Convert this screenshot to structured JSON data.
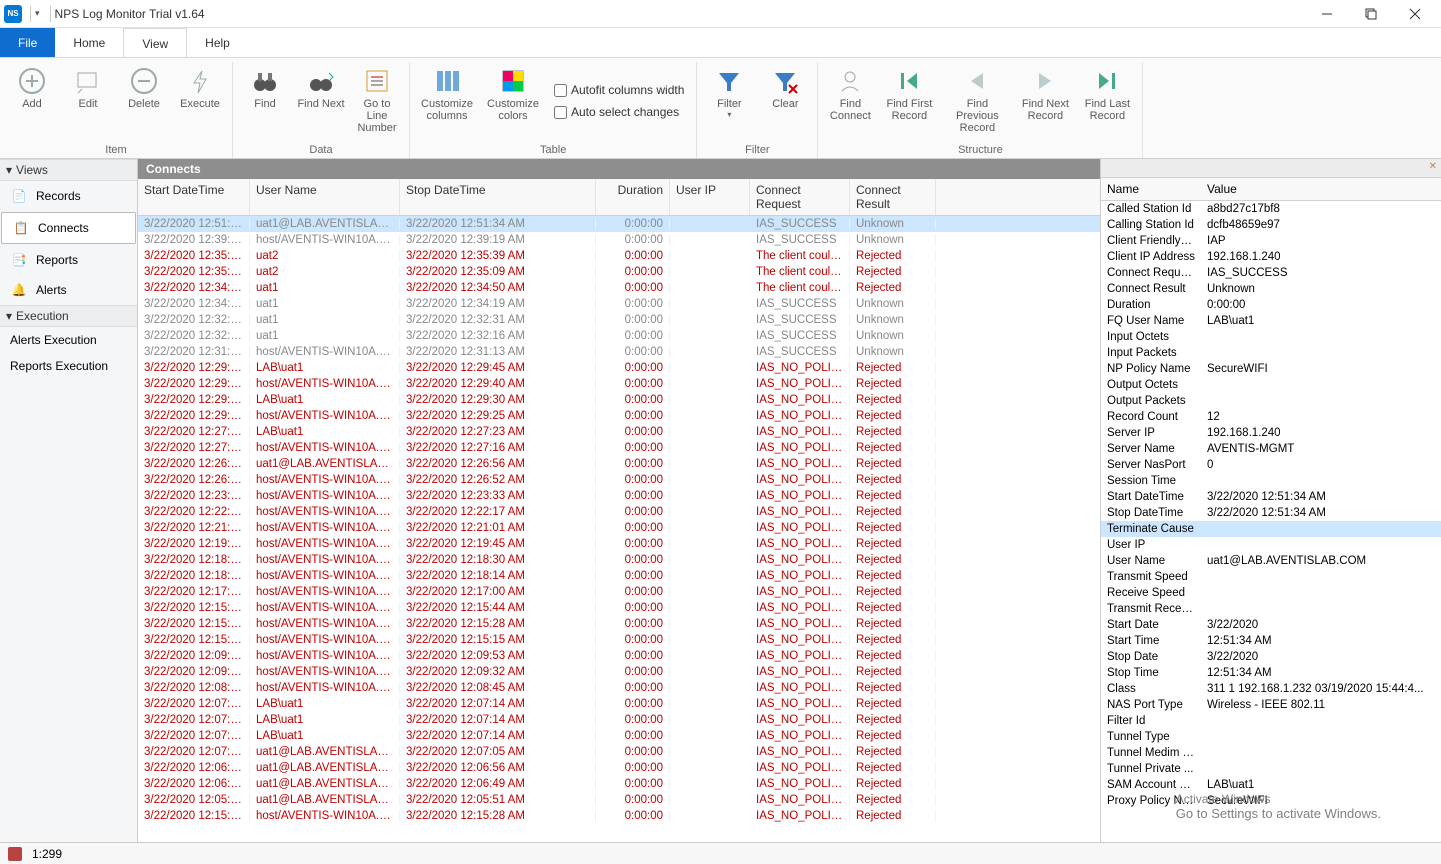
{
  "title": "NPS Log Monitor Trial v1.64",
  "menu": {
    "file": "File",
    "home": "Home",
    "view": "View",
    "help": "Help"
  },
  "ribbon": {
    "item": {
      "add": "Add",
      "edit": "Edit",
      "delete": "Delete",
      "execute": "Execute",
      "label": "Item"
    },
    "data": {
      "find": "Find",
      "findnext": "Find\nNext",
      "gotoline": "Go to Line\nNumber",
      "label": "Data"
    },
    "table": {
      "custcols": "Customize\ncolumns",
      "custcolors": "Customize\ncolors",
      "autofit": "Autofit columns width",
      "autoselect": "Auto select changes",
      "label": "Table"
    },
    "filter": {
      "filter": "Filter",
      "clear": "Clear",
      "label": "Filter"
    },
    "structure": {
      "findconnect": "Find\nConnect",
      "findfirst": "Find First\nRecord",
      "findprev": "Find Previous\nRecord",
      "findnext": "Find Next\nRecord",
      "findlast": "Find Last\nRecord",
      "label": "Structure"
    }
  },
  "leftnav": {
    "views": "Views",
    "records": "Records",
    "connects": "Connects",
    "reports": "Reports",
    "alerts": "Alerts",
    "execution": "Execution",
    "alerts_exec": "Alerts Execution",
    "reports_exec": "Reports Execution"
  },
  "grid": {
    "title": "Connects",
    "cols": [
      "Start DateTime",
      "User Name",
      "Stop DateTime",
      "Duration",
      "User IP",
      "Connect Request",
      "Connect Result"
    ],
    "rows": [
      {
        "cls": "gray sel",
        "c": [
          "3/22/2020 12:51:3...",
          "uat1@LAB.AVENTISLAB.COM",
          "3/22/2020 12:51:34 AM",
          "0:00:00",
          "",
          "IAS_SUCCESS",
          "Unknown"
        ]
      },
      {
        "cls": "gray",
        "c": [
          "3/22/2020 12:39:1...",
          "host/AVENTIS-WIN10A.LAB...",
          "3/22/2020 12:39:19 AM",
          "0:00:00",
          "",
          "IAS_SUCCESS",
          "Unknown"
        ]
      },
      {
        "cls": "red",
        "c": [
          "3/22/2020 12:35:3...",
          "uat2",
          "3/22/2020 12:35:39 AM",
          "0:00:00",
          "",
          "The client could ...",
          "Rejected"
        ]
      },
      {
        "cls": "red",
        "c": [
          "3/22/2020 12:35:0...",
          "uat2",
          "3/22/2020 12:35:09 AM",
          "0:00:00",
          "",
          "The client could ...",
          "Rejected"
        ]
      },
      {
        "cls": "red",
        "c": [
          "3/22/2020 12:34:5...",
          "uat1",
          "3/22/2020 12:34:50 AM",
          "0:00:00",
          "",
          "The client could ...",
          "Rejected"
        ]
      },
      {
        "cls": "gray",
        "c": [
          "3/22/2020 12:34:1...",
          "uat1",
          "3/22/2020 12:34:19 AM",
          "0:00:00",
          "",
          "IAS_SUCCESS",
          "Unknown"
        ]
      },
      {
        "cls": "gray",
        "c": [
          "3/22/2020 12:32:3...",
          "uat1",
          "3/22/2020 12:32:31 AM",
          "0:00:00",
          "",
          "IAS_SUCCESS",
          "Unknown"
        ]
      },
      {
        "cls": "gray",
        "c": [
          "3/22/2020 12:32:1...",
          "uat1",
          "3/22/2020 12:32:16 AM",
          "0:00:00",
          "",
          "IAS_SUCCESS",
          "Unknown"
        ]
      },
      {
        "cls": "gray",
        "c": [
          "3/22/2020 12:31:1...",
          "host/AVENTIS-WIN10A.LAB...",
          "3/22/2020 12:31:13 AM",
          "0:00:00",
          "",
          "IAS_SUCCESS",
          "Unknown"
        ]
      },
      {
        "cls": "red",
        "c": [
          "3/22/2020 12:29:4...",
          "LAB\\uat1",
          "3/22/2020 12:29:45 AM",
          "0:00:00",
          "",
          "IAS_NO_POLIC...",
          "Rejected"
        ]
      },
      {
        "cls": "red",
        "c": [
          "3/22/2020 12:29:4...",
          "host/AVENTIS-WIN10A.LAB...",
          "3/22/2020 12:29:40 AM",
          "0:00:00",
          "",
          "IAS_NO_POLIC...",
          "Rejected"
        ]
      },
      {
        "cls": "red",
        "c": [
          "3/22/2020 12:29:3...",
          "LAB\\uat1",
          "3/22/2020 12:29:30 AM",
          "0:00:00",
          "",
          "IAS_NO_POLIC...",
          "Rejected"
        ]
      },
      {
        "cls": "red",
        "c": [
          "3/22/2020 12:29:2...",
          "host/AVENTIS-WIN10A.LAB...",
          "3/22/2020 12:29:25 AM",
          "0:00:00",
          "",
          "IAS_NO_POLIC...",
          "Rejected"
        ]
      },
      {
        "cls": "red",
        "c": [
          "3/22/2020 12:27:2...",
          "LAB\\uat1",
          "3/22/2020 12:27:23 AM",
          "0:00:00",
          "",
          "IAS_NO_POLIC...",
          "Rejected"
        ]
      },
      {
        "cls": "red",
        "c": [
          "3/22/2020 12:27:1...",
          "host/AVENTIS-WIN10A.LAB...",
          "3/22/2020 12:27:16 AM",
          "0:00:00",
          "",
          "IAS_NO_POLIC...",
          "Rejected"
        ]
      },
      {
        "cls": "red",
        "c": [
          "3/22/2020 12:26:5...",
          "uat1@LAB.AVENTISLAB.COM",
          "3/22/2020 12:26:56 AM",
          "0:00:00",
          "",
          "IAS_NO_POLIC...",
          "Rejected"
        ]
      },
      {
        "cls": "red",
        "c": [
          "3/22/2020 12:26:5...",
          "host/AVENTIS-WIN10A.LAB...",
          "3/22/2020 12:26:52 AM",
          "0:00:00",
          "",
          "IAS_NO_POLIC...",
          "Rejected"
        ]
      },
      {
        "cls": "red",
        "c": [
          "3/22/2020 12:23:3...",
          "host/AVENTIS-WIN10A.LAB...",
          "3/22/2020 12:23:33 AM",
          "0:00:00",
          "",
          "IAS_NO_POLIC...",
          "Rejected"
        ]
      },
      {
        "cls": "red",
        "c": [
          "3/22/2020 12:22:1...",
          "host/AVENTIS-WIN10A.LAB...",
          "3/22/2020 12:22:17 AM",
          "0:00:00",
          "",
          "IAS_NO_POLIC...",
          "Rejected"
        ]
      },
      {
        "cls": "red",
        "c": [
          "3/22/2020 12:21:0...",
          "host/AVENTIS-WIN10A.LAB...",
          "3/22/2020 12:21:01 AM",
          "0:00:00",
          "",
          "IAS_NO_POLIC...",
          "Rejected"
        ]
      },
      {
        "cls": "red",
        "c": [
          "3/22/2020 12:19:4...",
          "host/AVENTIS-WIN10A.LAB...",
          "3/22/2020 12:19:45 AM",
          "0:00:00",
          "",
          "IAS_NO_POLIC...",
          "Rejected"
        ]
      },
      {
        "cls": "red",
        "c": [
          "3/22/2020 12:18:3...",
          "host/AVENTIS-WIN10A.LAB...",
          "3/22/2020 12:18:30 AM",
          "0:00:00",
          "",
          "IAS_NO_POLIC...",
          "Rejected"
        ]
      },
      {
        "cls": "red",
        "c": [
          "3/22/2020 12:18:1...",
          "host/AVENTIS-WIN10A.LAB...",
          "3/22/2020 12:18:14 AM",
          "0:00:00",
          "",
          "IAS_NO_POLIC...",
          "Rejected"
        ]
      },
      {
        "cls": "red",
        "c": [
          "3/22/2020 12:17:0...",
          "host/AVENTIS-WIN10A.LAB...",
          "3/22/2020 12:17:00 AM",
          "0:00:00",
          "",
          "IAS_NO_POLIC...",
          "Rejected"
        ]
      },
      {
        "cls": "red",
        "c": [
          "3/22/2020 12:15:4...",
          "host/AVENTIS-WIN10A.LAB...",
          "3/22/2020 12:15:44 AM",
          "0:00:00",
          "",
          "IAS_NO_POLIC...",
          "Rejected"
        ]
      },
      {
        "cls": "red",
        "c": [
          "3/22/2020 12:15:2...",
          "host/AVENTIS-WIN10A.LAB...",
          "3/22/2020 12:15:28 AM",
          "0:00:00",
          "",
          "IAS_NO_POLIC...",
          "Rejected"
        ]
      },
      {
        "cls": "red",
        "c": [
          "3/22/2020 12:15:1...",
          "host/AVENTIS-WIN10A.LAB...",
          "3/22/2020 12:15:15 AM",
          "0:00:00",
          "",
          "IAS_NO_POLIC...",
          "Rejected"
        ]
      },
      {
        "cls": "red",
        "c": [
          "3/22/2020 12:09:5...",
          "host/AVENTIS-WIN10A.LAB...",
          "3/22/2020 12:09:53 AM",
          "0:00:00",
          "",
          "IAS_NO_POLIC...",
          "Rejected"
        ]
      },
      {
        "cls": "red",
        "c": [
          "3/22/2020 12:09:3...",
          "host/AVENTIS-WIN10A.LAB...",
          "3/22/2020 12:09:32 AM",
          "0:00:00",
          "",
          "IAS_NO_POLIC...",
          "Rejected"
        ]
      },
      {
        "cls": "red",
        "c": [
          "3/22/2020 12:08:4...",
          "host/AVENTIS-WIN10A.LAB...",
          "3/22/2020 12:08:45 AM",
          "0:00:00",
          "",
          "IAS_NO_POLIC...",
          "Rejected"
        ]
      },
      {
        "cls": "red",
        "c": [
          "3/22/2020 12:07:1...",
          "LAB\\uat1",
          "3/22/2020 12:07:14 AM",
          "0:00:00",
          "",
          "IAS_NO_POLIC...",
          "Rejected"
        ]
      },
      {
        "cls": "red",
        "c": [
          "3/22/2020 12:07:1...",
          "LAB\\uat1",
          "3/22/2020 12:07:14 AM",
          "0:00:00",
          "",
          "IAS_NO_POLIC...",
          "Rejected"
        ]
      },
      {
        "cls": "red",
        "c": [
          "3/22/2020 12:07:1...",
          "LAB\\uat1",
          "3/22/2020 12:07:14 AM",
          "0:00:00",
          "",
          "IAS_NO_POLIC...",
          "Rejected"
        ]
      },
      {
        "cls": "red",
        "c": [
          "3/22/2020 12:07:0...",
          "uat1@LAB.AVENTISLAB.COM",
          "3/22/2020 12:07:05 AM",
          "0:00:00",
          "",
          "IAS_NO_POLIC...",
          "Rejected"
        ]
      },
      {
        "cls": "red",
        "c": [
          "3/22/2020 12:06:5...",
          "uat1@LAB.AVENTISLAB.COM",
          "3/22/2020 12:06:56 AM",
          "0:00:00",
          "",
          "IAS_NO_POLIC...",
          "Rejected"
        ]
      },
      {
        "cls": "red",
        "c": [
          "3/22/2020 12:06:4...",
          "uat1@LAB.AVENTISLAB.COM",
          "3/22/2020 12:06:49 AM",
          "0:00:00",
          "",
          "IAS_NO_POLIC...",
          "Rejected"
        ]
      },
      {
        "cls": "red",
        "c": [
          "3/22/2020 12:05:5...",
          "uat1@LAB.AVENTISLAB.COM",
          "3/22/2020 12:05:51 AM",
          "0:00:00",
          "",
          "IAS_NO_POLIC...",
          "Rejected"
        ]
      },
      {
        "cls": "red",
        "c": [
          "3/22/2020 12:15:2...",
          "host/AVENTIS-WIN10A.LAB...",
          "3/22/2020 12:15:28 AM",
          "0:00:00",
          "",
          "IAS_NO_POLIC...",
          "Rejected"
        ]
      }
    ]
  },
  "details": {
    "hn": "Name",
    "hv": "Value",
    "rows": [
      [
        "Called Station Id",
        "a8bd27c17bf8",
        false
      ],
      [
        "Calling Station Id",
        "dcfb48659e97",
        false
      ],
      [
        "Client Friendly N...",
        "IAP",
        false
      ],
      [
        "Client IP Address",
        "192.168.1.240",
        false
      ],
      [
        "Connect Request",
        "IAS_SUCCESS",
        false
      ],
      [
        "Connect Result",
        "Unknown",
        false
      ],
      [
        "Duration",
        "0:00:00",
        false
      ],
      [
        "FQ User Name",
        "LAB\\uat1",
        false
      ],
      [
        "Input Octets",
        "",
        false
      ],
      [
        "Input Packets",
        "",
        false
      ],
      [
        "NP Policy Name",
        "SecureWIFI",
        false
      ],
      [
        "Output Octets",
        "",
        false
      ],
      [
        "Output Packets",
        "",
        false
      ],
      [
        "Record Count",
        "12",
        false
      ],
      [
        "Server IP",
        "192.168.1.240",
        false
      ],
      [
        "Server Name",
        "AVENTIS-MGMT",
        false
      ],
      [
        "Server NasPort",
        "0",
        false
      ],
      [
        "Session Time",
        "",
        false
      ],
      [
        "Start DateTime",
        "3/22/2020 12:51:34 AM",
        false
      ],
      [
        "Stop DateTime",
        "3/22/2020 12:51:34 AM",
        false
      ],
      [
        "Terminate Cause",
        "",
        true
      ],
      [
        "User IP",
        "",
        false
      ],
      [
        "User Name",
        "uat1@LAB.AVENTISLAB.COM",
        false
      ],
      [
        "Transmit Speed",
        "",
        false
      ],
      [
        "Receive Speed",
        "",
        false
      ],
      [
        "Transmit Receiv...",
        "",
        false
      ],
      [
        "Start Date",
        "3/22/2020",
        false
      ],
      [
        "Start Time",
        "12:51:34 AM",
        false
      ],
      [
        "Stop Date",
        "3/22/2020",
        false
      ],
      [
        "Stop Time",
        "12:51:34 AM",
        false
      ],
      [
        "Class",
        "311 1 192.168.1.232 03/19/2020 15:44:4...",
        false
      ],
      [
        "NAS Port Type",
        "Wireless - IEEE 802.11",
        false
      ],
      [
        "Filter Id",
        "",
        false
      ],
      [
        "Tunnel Type",
        "",
        false
      ],
      [
        "Tunnel Medim T...",
        "",
        false
      ],
      [
        "Tunnel Private ...",
        "",
        false
      ],
      [
        "SAM Account N...",
        "LAB\\uat1",
        false
      ],
      [
        "Proxy Policy Name",
        "SecureWIFI",
        false
      ]
    ]
  },
  "status": {
    "pos": "1:299"
  },
  "watermark": {
    "t": "Activate Windows",
    "s": "Go to Settings to activate Windows."
  }
}
